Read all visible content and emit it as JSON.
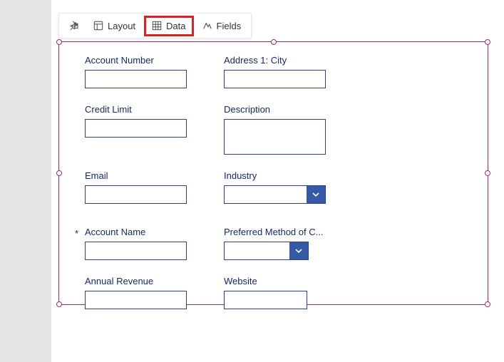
{
  "toolbar": {
    "layout_label": "Layout",
    "data_label": "Data",
    "fields_label": "Fields"
  },
  "fields": {
    "account_number": {
      "label": "Account Number"
    },
    "address1_city": {
      "label": "Address 1: City"
    },
    "credit_limit": {
      "label": "Credit Limit"
    },
    "description": {
      "label": "Description"
    },
    "email": {
      "label": "Email"
    },
    "industry": {
      "label": "Industry"
    },
    "account_name": {
      "label": "Account Name",
      "required_marker": "*"
    },
    "preferred_method": {
      "label": "Preferred Method of C..."
    },
    "annual_revenue": {
      "label": "Annual Revenue"
    },
    "website": {
      "label": "Website"
    }
  }
}
